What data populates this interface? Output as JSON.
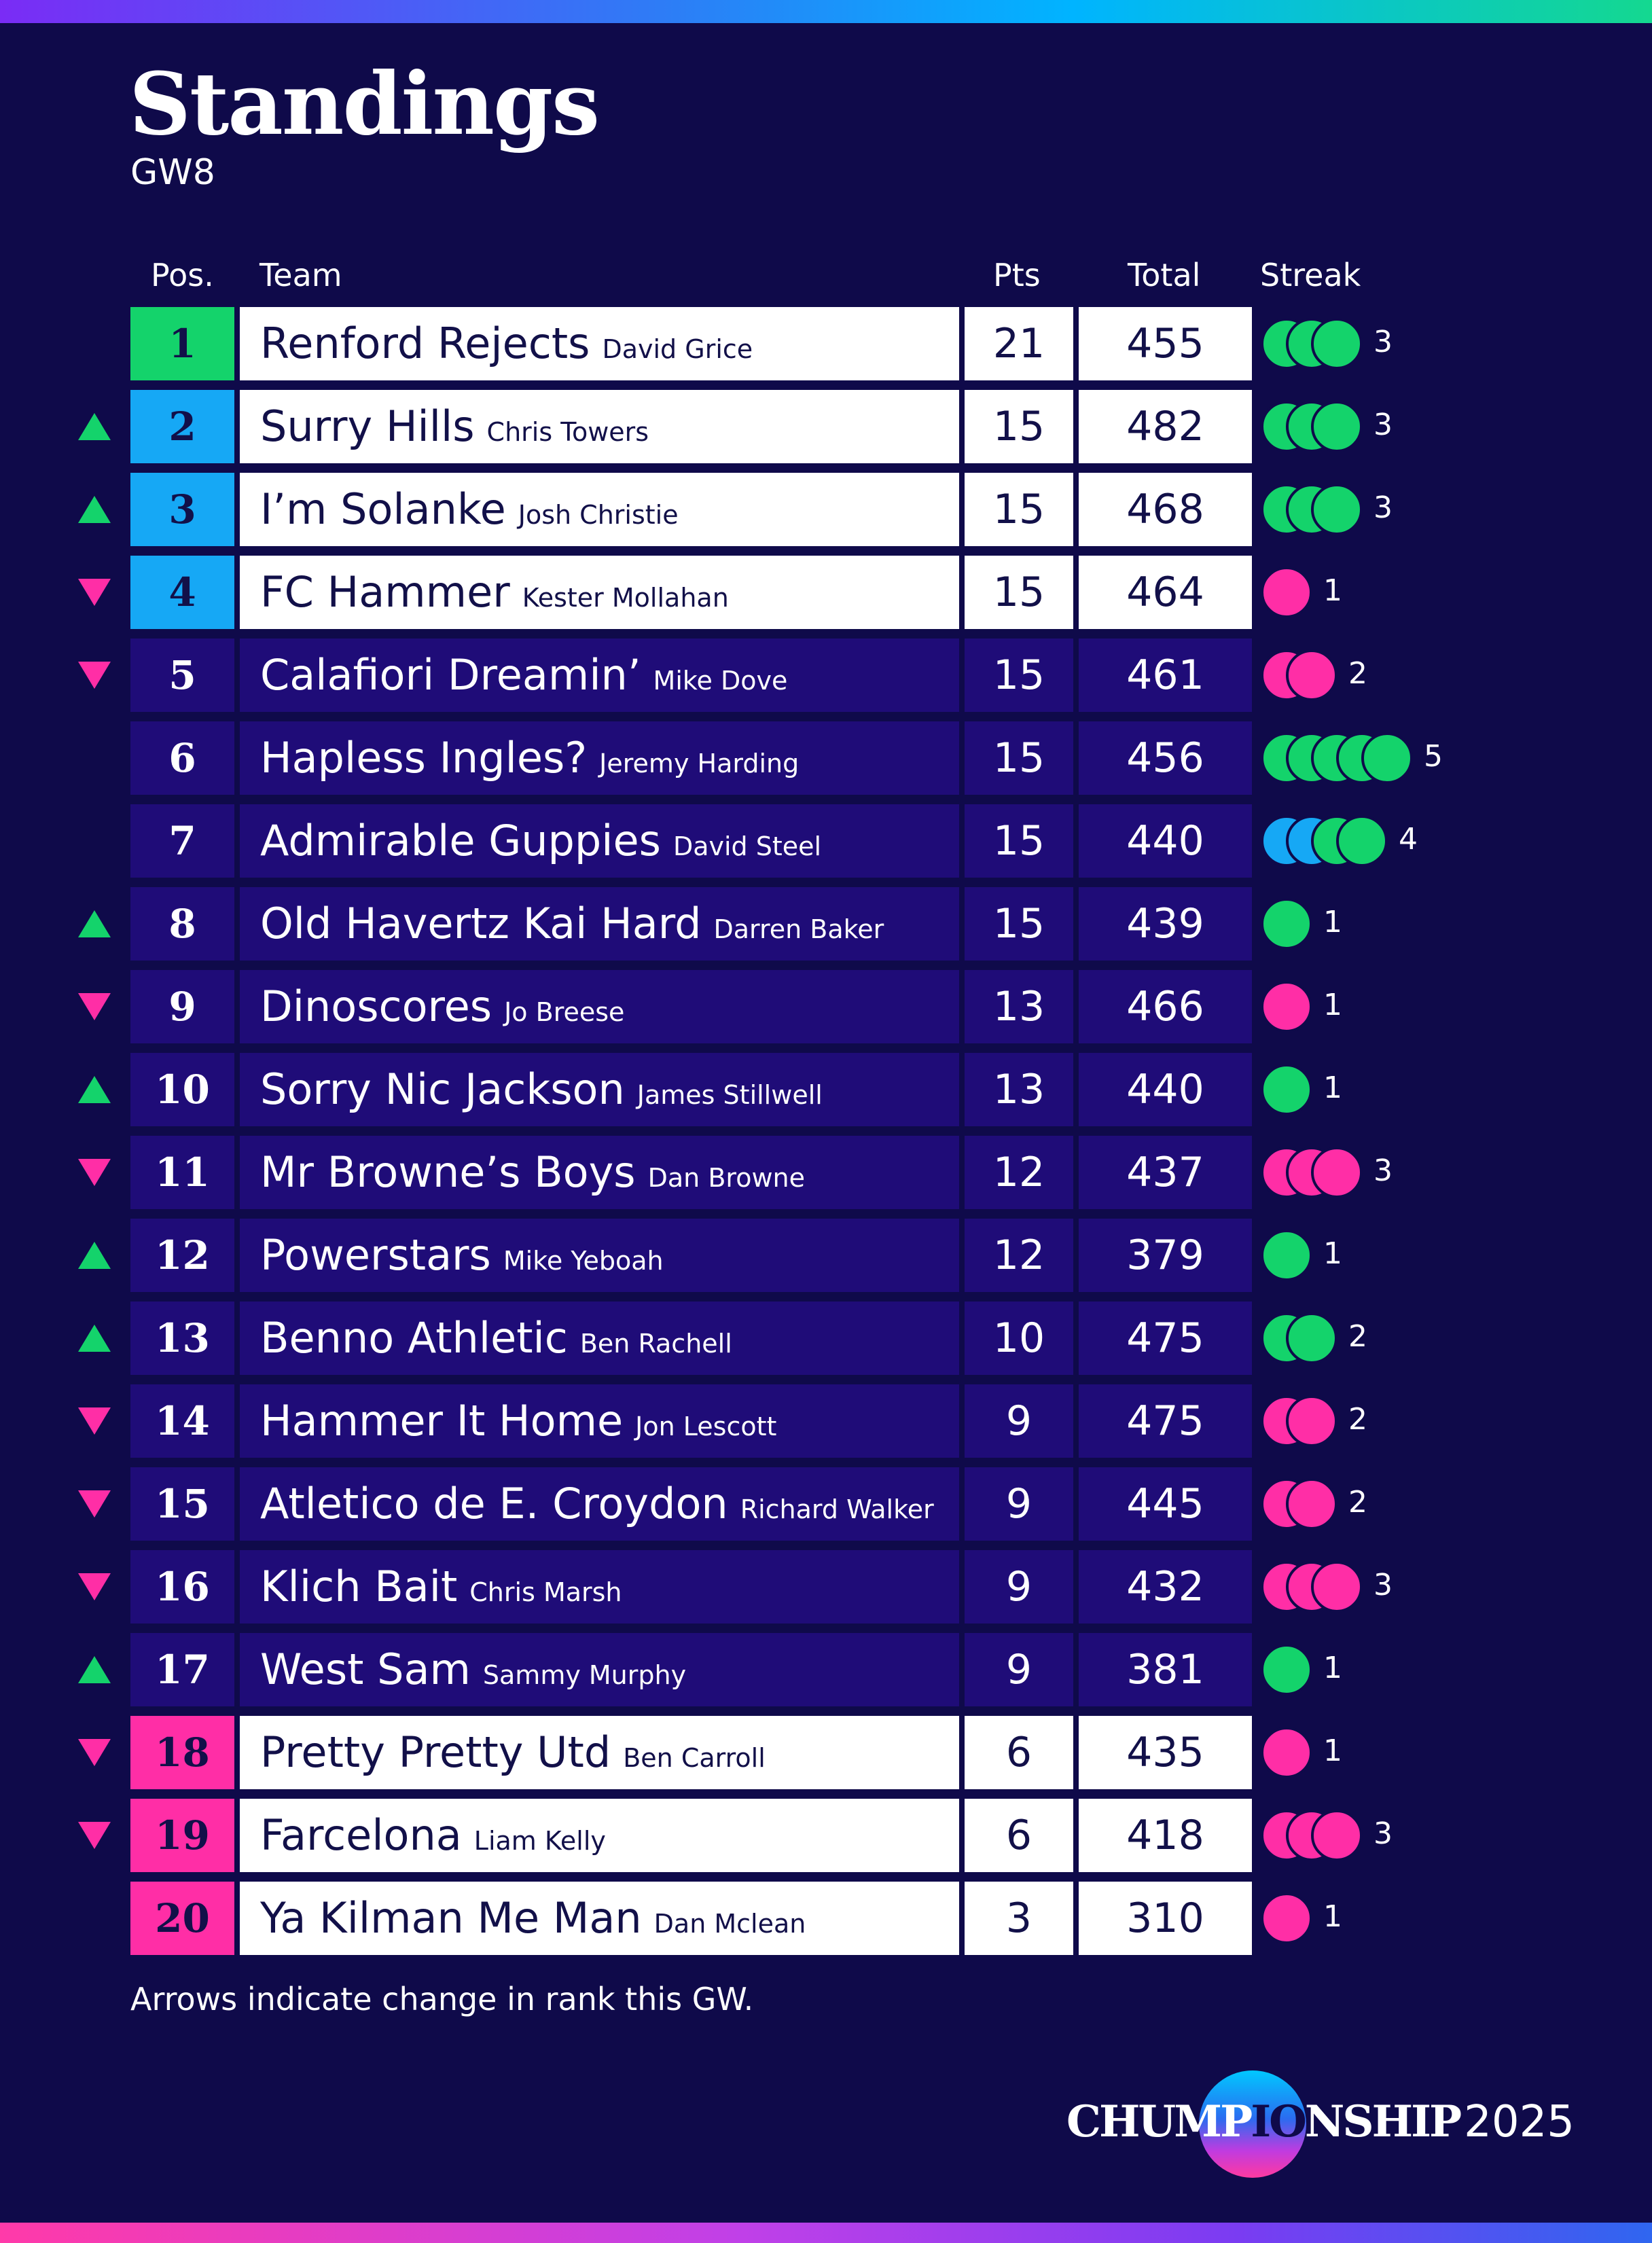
{
  "page": {
    "title": "Standings",
    "subtitle": "GW8",
    "footnote": "Arrows indicate change in rank this GW."
  },
  "headers": {
    "pos": "Pos.",
    "team": "Team",
    "pts": "Pts",
    "total": "Total",
    "streak": "Streak"
  },
  "colors": {
    "background": "#0f0a4a",
    "row_dark": "#1f0c78",
    "row_light": "#ffffff",
    "champion_green": "#14d36b",
    "promotion_blue": "#16a8f5",
    "relegation_pink": "#ff2ea6",
    "arrow_up": "#14d36b",
    "arrow_down": "#ff2ea6",
    "streak_win": "#14d36b",
    "streak_loss": "#ff2ea6",
    "streak_draw": "#16a8f5"
  },
  "legend": {
    "W": "win",
    "L": "loss",
    "D": "draw"
  },
  "standings": [
    {
      "pos": "1",
      "team": "Renford Rejects",
      "manager": "David Grice",
      "pts": "21",
      "total": "455",
      "move": "none",
      "zone": "champion",
      "streak": [
        "W",
        "W",
        "W"
      ],
      "streak_count": "3"
    },
    {
      "pos": "2",
      "team": "Surry Hills",
      "manager": "Chris Towers",
      "pts": "15",
      "total": "482",
      "move": "up",
      "zone": "promotion",
      "streak": [
        "W",
        "W",
        "W"
      ],
      "streak_count": "3"
    },
    {
      "pos": "3",
      "team": "I’m Solanke",
      "manager": "Josh Christie",
      "pts": "15",
      "total": "468",
      "move": "up",
      "zone": "promotion",
      "streak": [
        "W",
        "W",
        "W"
      ],
      "streak_count": "3"
    },
    {
      "pos": "4",
      "team": "FC Hammer",
      "manager": "Kester Mollahan",
      "pts": "15",
      "total": "464",
      "move": "down",
      "zone": "promotion",
      "streak": [
        "L"
      ],
      "streak_count": "1"
    },
    {
      "pos": "5",
      "team": "Calafiori Dreamin’",
      "manager": "Mike Dove",
      "pts": "15",
      "total": "461",
      "move": "down",
      "zone": "mid",
      "streak": [
        "L",
        "L"
      ],
      "streak_count": "2"
    },
    {
      "pos": "6",
      "team": "Hapless Ingles?",
      "manager": "Jeremy Harding",
      "pts": "15",
      "total": "456",
      "move": "none",
      "zone": "mid",
      "streak": [
        "W",
        "W",
        "W",
        "W",
        "W"
      ],
      "streak_count": "5"
    },
    {
      "pos": "7",
      "team": "Admirable Guppies",
      "manager": "David Steel",
      "pts": "15",
      "total": "440",
      "move": "none",
      "zone": "mid",
      "streak": [
        "D",
        "D",
        "W",
        "W"
      ],
      "streak_count": "4"
    },
    {
      "pos": "8",
      "team": "Old Havertz Kai Hard",
      "manager": "Darren Baker",
      "pts": "15",
      "total": "439",
      "move": "up",
      "zone": "mid",
      "streak": [
        "W"
      ],
      "streak_count": "1"
    },
    {
      "pos": "9",
      "team": "Dinoscores",
      "manager": "Jo Breese",
      "pts": "13",
      "total": "466",
      "move": "down",
      "zone": "mid",
      "streak": [
        "L"
      ],
      "streak_count": "1"
    },
    {
      "pos": "10",
      "team": "Sorry Nic Jackson",
      "manager": "James Stillwell",
      "pts": "13",
      "total": "440",
      "move": "up",
      "zone": "mid",
      "streak": [
        "W"
      ],
      "streak_count": "1"
    },
    {
      "pos": "11",
      "team": "Mr Browne’s Boys",
      "manager": "Dan Browne",
      "pts": "12",
      "total": "437",
      "move": "down",
      "zone": "mid",
      "streak": [
        "L",
        "L",
        "L"
      ],
      "streak_count": "3"
    },
    {
      "pos": "12",
      "team": "Powerstars",
      "manager": "Mike Yeboah",
      "pts": "12",
      "total": "379",
      "move": "up",
      "zone": "mid",
      "streak": [
        "W"
      ],
      "streak_count": "1"
    },
    {
      "pos": "13",
      "team": "Benno Athletic",
      "manager": "Ben Rachell",
      "pts": "10",
      "total": "475",
      "move": "up",
      "zone": "mid",
      "streak": [
        "W",
        "W"
      ],
      "streak_count": "2"
    },
    {
      "pos": "14",
      "team": "Hammer It Home",
      "manager": "Jon Lescott",
      "pts": "9",
      "total": "475",
      "move": "down",
      "zone": "mid",
      "streak": [
        "L",
        "L"
      ],
      "streak_count": "2"
    },
    {
      "pos": "15",
      "team": "Atletico de E. Croydon",
      "manager": "Richard Walker",
      "pts": "9",
      "total": "445",
      "move": "down",
      "zone": "mid",
      "streak": [
        "L",
        "L"
      ],
      "streak_count": "2"
    },
    {
      "pos": "16",
      "team": "Klich Bait",
      "manager": "Chris Marsh",
      "pts": "9",
      "total": "432",
      "move": "down",
      "zone": "mid",
      "streak": [
        "L",
        "L",
        "L"
      ],
      "streak_count": "3"
    },
    {
      "pos": "17",
      "team": "West Sam",
      "manager": "Sammy Murphy",
      "pts": "9",
      "total": "381",
      "move": "up",
      "zone": "mid",
      "streak": [
        "W"
      ],
      "streak_count": "1"
    },
    {
      "pos": "18",
      "team": "Pretty Pretty Utd",
      "manager": "Ben Carroll",
      "pts": "6",
      "total": "435",
      "move": "down",
      "zone": "relegation",
      "streak": [
        "L"
      ],
      "streak_count": "1"
    },
    {
      "pos": "19",
      "team": "Farcelona",
      "manager": "Liam Kelly",
      "pts": "6",
      "total": "418",
      "move": "down",
      "zone": "relegation",
      "streak": [
        "L",
        "L",
        "L"
      ],
      "streak_count": "3"
    },
    {
      "pos": "20",
      "team": "Ya Kilman Me Man",
      "manager": "Dan Mclean",
      "pts": "3",
      "total": "310",
      "move": "none",
      "zone": "relegation",
      "streak": [
        "L"
      ],
      "streak_count": "1"
    }
  ],
  "brand": {
    "name_pre": "CHUMP",
    "name_mid": "IO",
    "name_post": "NSHIP",
    "year": "2025"
  }
}
